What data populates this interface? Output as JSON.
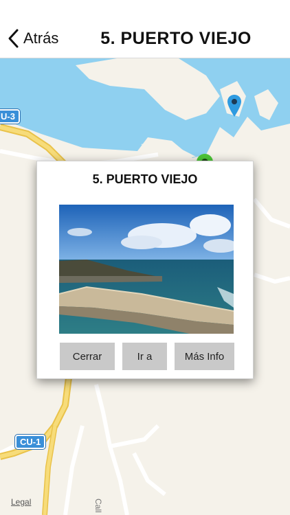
{
  "nav": {
    "back_label": "Atrás",
    "title": "5. PUERTO VIEJO"
  },
  "map": {
    "badges": [
      "U-3",
      "CU-1"
    ],
    "legal": "Legal",
    "street_fragment": "Call"
  },
  "popup": {
    "title": "5. PUERTO VIEJO",
    "buttons": {
      "close": "Cerrar",
      "goto": "Ir a",
      "more_info": "Más Info"
    }
  },
  "colors": {
    "water": "#8fd0f0",
    "land": "#f5f2ea",
    "road": "#f3cf56",
    "pin_blue": "#2f9be0",
    "pin_green": "#4cc637",
    "button": "#c9c9c9"
  }
}
